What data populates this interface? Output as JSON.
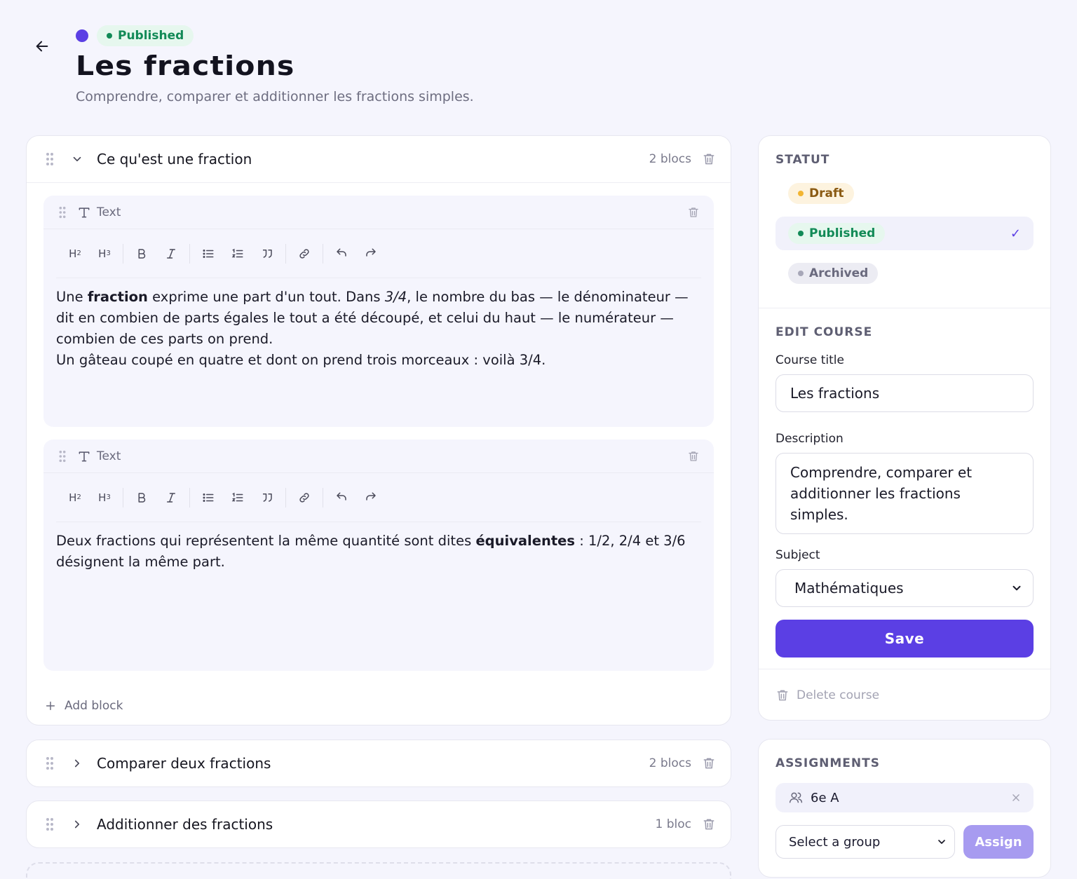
{
  "header": {
    "status_badge": "Published",
    "title": "Les fractions",
    "description": "Comprendre, comparer et additionner les fractions simples."
  },
  "sections": [
    {
      "title": "Ce qu'est une fraction",
      "count": "2 blocs",
      "expanded": true,
      "blocks": [
        {
          "type_label": "Text",
          "paragraphs": [
            [
              {
                "t": "Une "
              },
              {
                "t": "fraction",
                "b": true
              },
              {
                "t": " exprime une part d'un tout. Dans "
              },
              {
                "t": "3/4",
                "i": true
              },
              {
                "t": ", le nombre du bas — le dénominateur — dit en combien de parts égales le tout a été découpé, et celui du haut — le numérateur — combien de ces parts on prend."
              }
            ],
            [
              {
                "t": "Un gâteau coupé en quatre et dont on prend trois morceaux : voilà 3/4."
              }
            ]
          ]
        },
        {
          "type_label": "Text",
          "paragraphs": [
            [
              {
                "t": "Deux fractions qui représentent la même quantité sont dites "
              },
              {
                "t": "équivalentes",
                "b": true
              },
              {
                "t": " : 1/2, 2/4 et 3/6 désignent la même part."
              }
            ]
          ]
        }
      ],
      "add_block_label": "Add block"
    },
    {
      "title": "Comparer deux fractions",
      "count": "2 blocs",
      "expanded": false
    },
    {
      "title": "Additionner des fractions",
      "count": "1 bloc",
      "expanded": false
    }
  ],
  "toolbar": {
    "h2": "H",
    "h2_sub": "2",
    "h3": "H",
    "h3_sub": "3"
  },
  "sidebar": {
    "statut_label": "STATUT",
    "statuses": [
      {
        "label": "Draft",
        "kind": "draft",
        "active": false
      },
      {
        "label": "Published",
        "kind": "published",
        "active": true
      },
      {
        "label": "Archived",
        "kind": "archived",
        "active": false
      }
    ],
    "check_mark": "✓",
    "edit_label": "EDIT COURSE",
    "course_title_label": "Course title",
    "course_title_value": "Les fractions",
    "description_label": "Description",
    "description_value": "Comprendre, comparer et additionner les fractions simples.",
    "subject_label": "Subject",
    "subject_value": "Mathématiques",
    "save_label": "Save",
    "delete_label": "Delete course"
  },
  "assignments": {
    "label": "ASSIGNMENTS",
    "items": [
      "6e A"
    ],
    "select_placeholder": "Select a group",
    "assign_label": "Assign"
  },
  "colors": {
    "accent": "#5b3fe4",
    "published": "#128a57",
    "draft": "#f2b532",
    "background": "#f5f5fd"
  }
}
